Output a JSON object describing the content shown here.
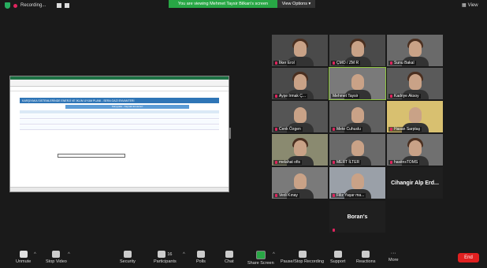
{
  "topbar": {
    "recording_label": "Recording...",
    "banner_text": "You are viewing Mehmet Taysir Bilkan's screen",
    "view_options_label": "View Options",
    "view_label": "View"
  },
  "shared_screen": {
    "sheet_title": "KARŞIYAKA SİSTEMLERİNDE ENERJİ VE İKLİM UYUM PLANI - SERA GAZI ENVANTERİ",
    "sheet_sub": "Karşıyaka - Kaynak Envanteri"
  },
  "participants": [
    {
      "name": "İlker Erol"
    },
    {
      "name": "ÇMO / ZM R"
    },
    {
      "name": "Sunu Bakal"
    },
    {
      "name": "Ayşe Irmak Ç..."
    },
    {
      "name": "Mehmet Taysir"
    },
    {
      "name": "Kadriye Aksoy"
    },
    {
      "name": "Cenk Özgen"
    },
    {
      "name": "Mete Cuhuslu"
    },
    {
      "name": "Hasan Sarptaş"
    },
    {
      "name": "melahat ofis"
    },
    {
      "name": "MERT İLTER"
    },
    {
      "name": "hasitnsTOMS"
    },
    {
      "name": "Cihangir Alp Erd..."
    },
    {
      "name": "Vedi Kınay"
    },
    {
      "name": "Filiz Yaşar ma..."
    },
    {
      "name": "Boran's"
    }
  ],
  "toolbar": {
    "unmute": "Unmute",
    "stop_video": "Stop Video",
    "security": "Security",
    "participants": "Participants",
    "participants_count": "16",
    "polls": "Polls",
    "chat": "Chat",
    "share_screen": "Share Screen",
    "pause_recording": "Pause/Stop Recording",
    "support": "Support",
    "reactions": "Reactions",
    "more": "More",
    "end": "End"
  },
  "colors": {
    "banner": "#28a745",
    "end": "#e02020",
    "active_speaker": "#8ec63f"
  }
}
